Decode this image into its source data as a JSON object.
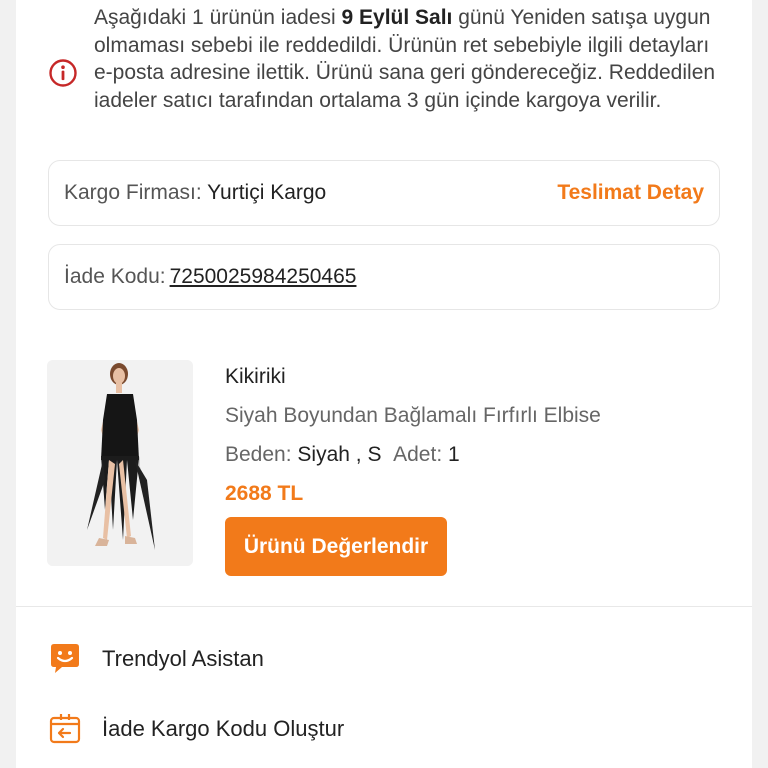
{
  "notice": {
    "text_before": "Aşağıdaki 1 ürünün iadesi ",
    "date": "9 Eylül Salı",
    "text_after": " günü Yeniden satışa uygun olmaması sebebi ile reddedildi. Ürünün ret sebebiyle ilgili detayları e-posta adresine ilettik. Ürünü sana geri göndereceğiz. Reddedilen iadeler satıcı tarafından ortalama 3 gün içinde kargoya verilir.",
    "icon": "info-icon",
    "icon_color": "#c62828"
  },
  "shipping": {
    "label": "Kargo Firması:",
    "carrier": "Yurtiçi Kargo",
    "detail_link": "Teslimat Detay"
  },
  "return_code": {
    "label": "İade Kodu:",
    "code": "7250025984250465"
  },
  "product": {
    "brand": "Kikiriki",
    "name": "Siyah Boyundan Bağlamalı Fırfırlı Elbise",
    "size_label": "Beden:",
    "size_value": "Siyah , S",
    "qty_label": "Adet:",
    "qty_value": "1",
    "price": "2688 TL",
    "rate_button": "Ürünü Değerlendir"
  },
  "actions": {
    "assistant": "Trendyol Asistan",
    "create_return_code": "İade Kargo Kodu Oluştur"
  },
  "colors": {
    "accent": "#f27a1a",
    "error": "#c62828"
  }
}
